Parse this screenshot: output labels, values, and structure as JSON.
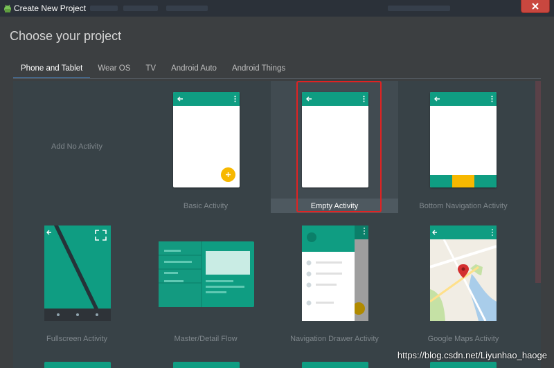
{
  "window": {
    "title": "Create New Project",
    "close_icon": "close-icon"
  },
  "dialog": {
    "heading": "Choose your project"
  },
  "tabs": [
    {
      "label": "Phone and Tablet",
      "active": true
    },
    {
      "label": "Wear OS",
      "active": false
    },
    {
      "label": "TV",
      "active": false
    },
    {
      "label": "Android Auto",
      "active": false
    },
    {
      "label": "Android Things",
      "active": false
    }
  ],
  "templates": [
    {
      "label": "Add No Activity"
    },
    {
      "label": "Basic Activity"
    },
    {
      "label": "Empty Activity",
      "selected": true
    },
    {
      "label": "Bottom Navigation Activity"
    },
    {
      "label": "Fullscreen Activity"
    },
    {
      "label": "Master/Detail Flow"
    },
    {
      "label": "Navigation Drawer Activity"
    },
    {
      "label": "Google Maps Activity"
    }
  ],
  "colors": {
    "accent": "#0f9d82",
    "fab": "#f7b800",
    "selection_outline": "#e02222"
  },
  "watermark": "https://blog.csdn.net/Liyunhao_haoge"
}
